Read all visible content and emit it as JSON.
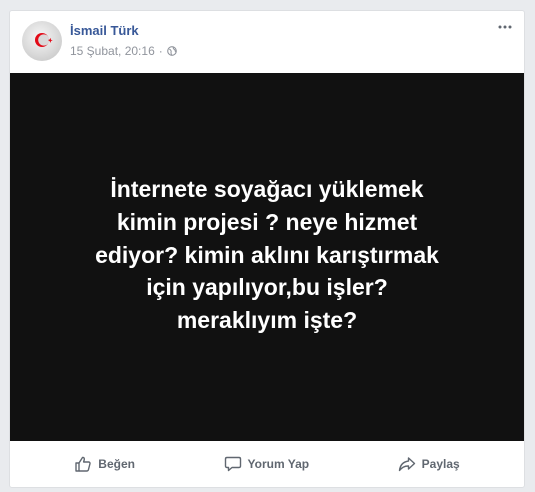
{
  "post": {
    "author_name": "İsmail Türk",
    "timestamp": "15 Şubat, 20:16",
    "separator": "·",
    "privacy_icon": "globe-icon",
    "image_text": "İnternete soyağacı yüklemek\nkimin projesi ? neye hizmet\nediyor? kimin aklını karıştırmak\niçin yapılıyor,bu işler?\nmeraklıyım işte?"
  },
  "actions": {
    "like_label": "Beğen",
    "comment_label": "Yorum Yap",
    "share_label": "Paylaş"
  },
  "colors": {
    "page_bg": "#e9ebee",
    "author_link": "#385898",
    "meta_text": "#90949c",
    "action_text": "#606770",
    "image_bg": "#111111"
  }
}
